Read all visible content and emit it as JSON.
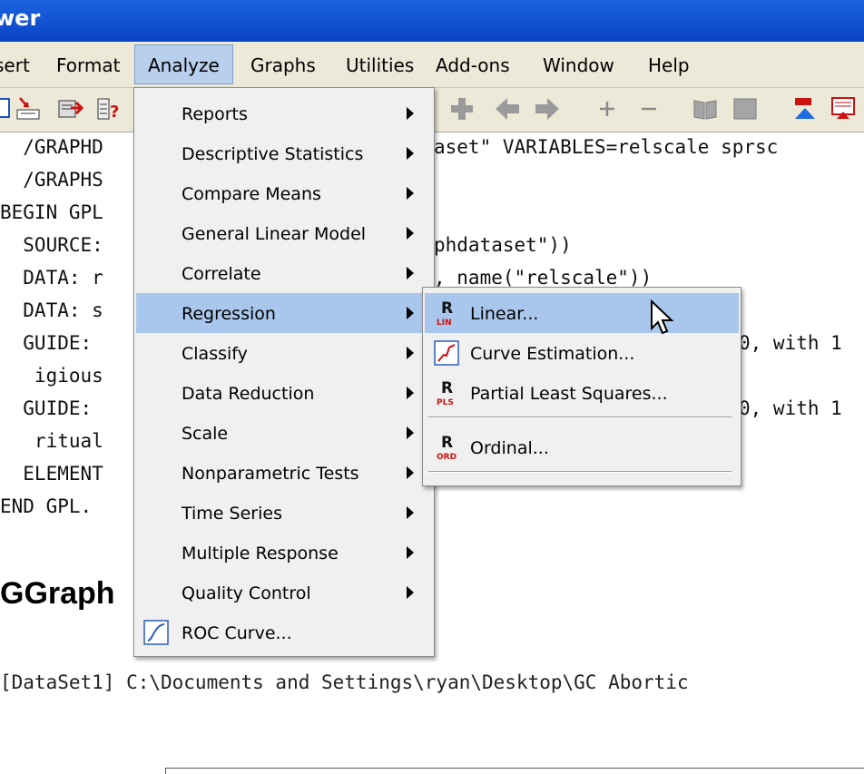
{
  "window": {
    "title_fragment": "wer"
  },
  "menubar": {
    "items": [
      "sert",
      "Format",
      "Analyze",
      "Graphs",
      "Utilities",
      "Add-ons",
      "Window",
      "Help"
    ]
  },
  "toolbar": {
    "icons": [
      "insert-cases-icon",
      "goto-case-icon",
      "export-icon",
      "variables-icon",
      "add-icon",
      "back-arrow-icon",
      "forward-arrow-icon",
      "expand-icon",
      "collapse-icon",
      "show-icon",
      "hide-icon",
      "demote-icon",
      "promote-icon"
    ]
  },
  "syntax": {
    "lines": [
      "  /GRAPHD",
      "  /GRAPHS",
      "BEGIN GPL",
      "  SOURCE:",
      "  DATA: r",
      "  DATA: s",
      "  GUIDE: ",
      "   igious",
      "  GUIDE: ",
      "   ritual",
      "  ELEMENT",
      "END GPL."
    ],
    "right_lines": [
      "aset\" VARIABLES=relscale sprsc",
      "",
      "",
      "phdataset\"))",
      ", name(\"relscale\"))",
      "",
      "0, with 1",
      "",
      "0, with 1"
    ]
  },
  "heading": "GGraph",
  "dataset_path": "[DataSet1] C:\\Documents and Settings\\ryan\\Desktop\\GC Abortic",
  "analyze_menu": {
    "items": [
      {
        "label": "Reports",
        "submenu": true
      },
      {
        "label": "Descriptive Statistics",
        "submenu": true
      },
      {
        "label": "Compare Means",
        "submenu": true
      },
      {
        "label": "General Linear Model",
        "submenu": true
      },
      {
        "label": "Correlate",
        "submenu": true
      },
      {
        "label": "Regression",
        "submenu": true
      },
      {
        "label": "Classify",
        "submenu": true
      },
      {
        "label": "Data Reduction",
        "submenu": true
      },
      {
        "label": "Scale",
        "submenu": true
      },
      {
        "label": "Nonparametric Tests",
        "submenu": true
      },
      {
        "label": "Time Series",
        "submenu": true
      },
      {
        "label": "Multiple Response",
        "submenu": true
      },
      {
        "label": "Quality Control",
        "submenu": true
      },
      {
        "label": "ROC Curve...",
        "submenu": false
      }
    ]
  },
  "regression_submenu": {
    "items": [
      {
        "label": "Linear...",
        "icon_text": "LIN"
      },
      {
        "label": "Curve Estimation..."
      },
      {
        "label": "Partial Least Squares...",
        "icon_text": "PLS"
      },
      {
        "label": "Ordinal...",
        "icon_text": "ORD"
      }
    ],
    "icon_letter": "R"
  },
  "colors": {
    "titlebar": "#0a44c4",
    "menu_highlight": "#a9c7ec",
    "menu_bg": "#f0f0f0",
    "icon_red": "#cc1111"
  }
}
